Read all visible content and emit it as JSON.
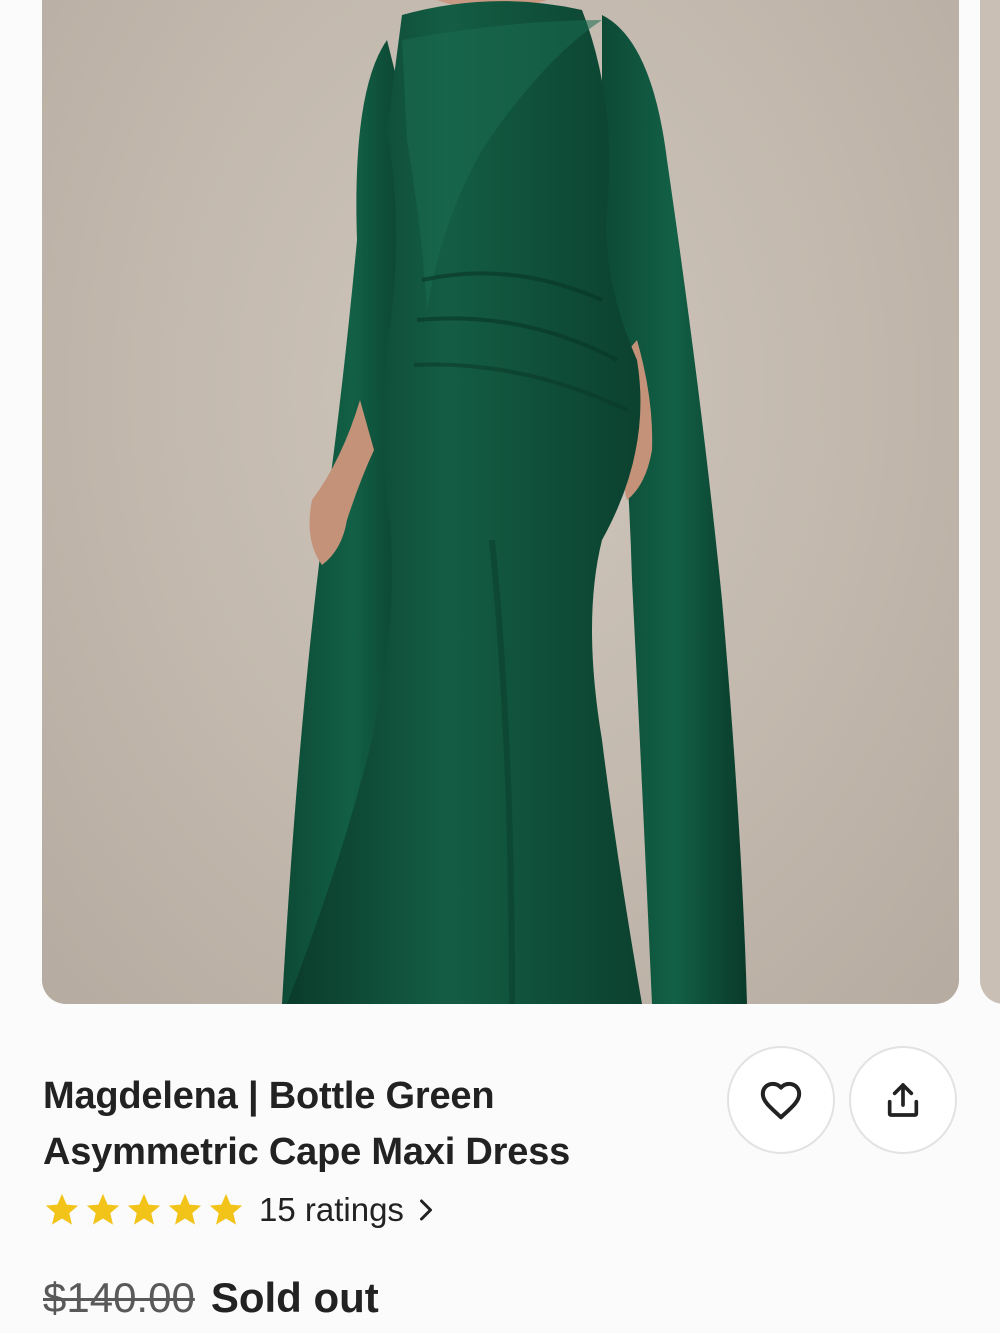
{
  "product": {
    "title_line1": "Magdelena | Bottle Green",
    "title_line2": "Asymmetric Cape Maxi Dress",
    "image_alt": "Model wearing a bottle green cape maxi dress"
  },
  "rating": {
    "stars": 5,
    "count_label": "15 ratings",
    "star_color": "#f2c318"
  },
  "price": {
    "original": "$140.00",
    "status": "Sold out"
  },
  "actions": {
    "favorite_icon": "heart-icon",
    "share_icon": "share-icon"
  },
  "colors": {
    "dress": "#0f4f3a",
    "backdrop": "#c4bab0"
  }
}
